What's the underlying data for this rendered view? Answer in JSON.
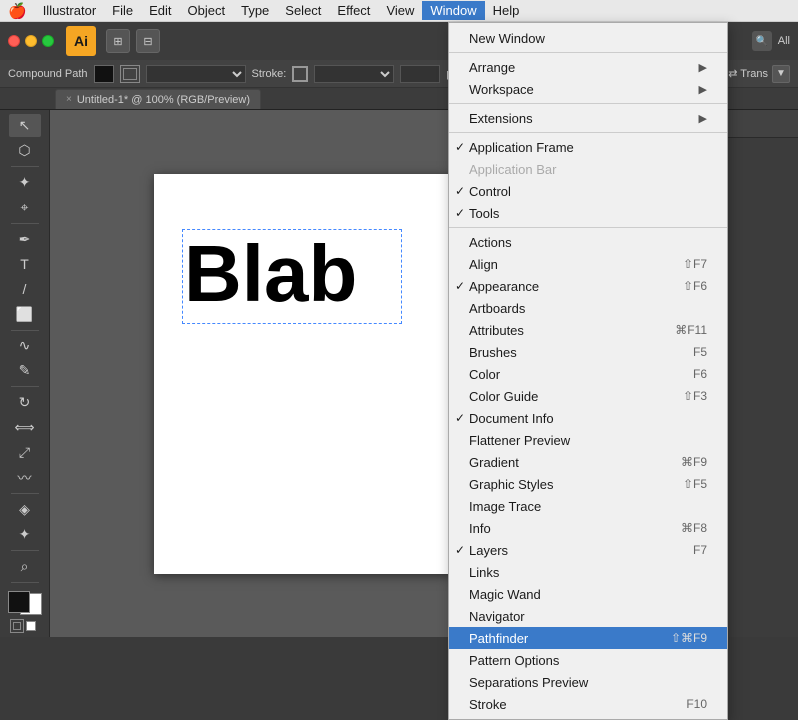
{
  "menubar": {
    "apple": "🍎",
    "items": [
      {
        "label": "Illustrator",
        "active": false
      },
      {
        "label": "File",
        "active": false
      },
      {
        "label": "Edit",
        "active": false
      },
      {
        "label": "Object",
        "active": false
      },
      {
        "label": "Type",
        "active": false
      },
      {
        "label": "Select",
        "active": false
      },
      {
        "label": "Effect",
        "active": false
      },
      {
        "label": "View",
        "active": false
      },
      {
        "label": "Window",
        "active": true
      },
      {
        "label": "Help",
        "active": false
      }
    ]
  },
  "titlebar": {
    "ai_logo": "Ai",
    "icons": [
      "⬜",
      "⬛"
    ]
  },
  "optionsbar": {
    "path_label": "Compound Path",
    "stroke_label": "Stroke:",
    "fill_value": "",
    "stroke_value": ""
  },
  "tab": {
    "close": "×",
    "title": "Untitled-1* @ 100% (RGB/Preview)"
  },
  "canvas": {
    "text": "Blab"
  },
  "window_menu": {
    "items": [
      {
        "label": "New Window",
        "shortcut": "",
        "check": false,
        "disabled": false,
        "submenu": false,
        "separator_after": true
      },
      {
        "label": "Arrange",
        "shortcut": "",
        "check": false,
        "disabled": false,
        "submenu": true,
        "separator_after": false
      },
      {
        "label": "Workspace",
        "shortcut": "",
        "check": false,
        "disabled": false,
        "submenu": true,
        "separator_after": true
      },
      {
        "label": "Extensions",
        "shortcut": "",
        "check": false,
        "disabled": false,
        "submenu": true,
        "separator_after": true
      },
      {
        "label": "Application Frame",
        "shortcut": "",
        "check": true,
        "disabled": false,
        "submenu": false,
        "separator_after": false
      },
      {
        "label": "Application Bar",
        "shortcut": "",
        "check": false,
        "disabled": true,
        "submenu": false,
        "separator_after": false
      },
      {
        "label": "Control",
        "shortcut": "",
        "check": true,
        "disabled": false,
        "submenu": false,
        "separator_after": false
      },
      {
        "label": "Tools",
        "shortcut": "",
        "check": true,
        "disabled": false,
        "submenu": false,
        "separator_after": true
      },
      {
        "label": "Actions",
        "shortcut": "",
        "check": false,
        "disabled": false,
        "submenu": false,
        "separator_after": false
      },
      {
        "label": "Align",
        "shortcut": "⇧F7",
        "check": false,
        "disabled": false,
        "submenu": false,
        "separator_after": false
      },
      {
        "label": "Appearance",
        "shortcut": "⇧F6",
        "check": true,
        "disabled": false,
        "submenu": false,
        "separator_after": false
      },
      {
        "label": "Artboards",
        "shortcut": "",
        "check": false,
        "disabled": false,
        "submenu": false,
        "separator_after": false
      },
      {
        "label": "Attributes",
        "shortcut": "⌘F11",
        "check": false,
        "disabled": false,
        "submenu": false,
        "separator_after": false
      },
      {
        "label": "Brushes",
        "shortcut": "F5",
        "check": false,
        "disabled": false,
        "submenu": false,
        "separator_after": false
      },
      {
        "label": "Color",
        "shortcut": "F6",
        "check": false,
        "disabled": false,
        "submenu": false,
        "separator_after": false
      },
      {
        "label": "Color Guide",
        "shortcut": "⇧F3",
        "check": false,
        "disabled": false,
        "submenu": false,
        "separator_after": false
      },
      {
        "label": "Document Info",
        "shortcut": "",
        "check": true,
        "disabled": false,
        "submenu": false,
        "separator_after": false
      },
      {
        "label": "Flattener Preview",
        "shortcut": "",
        "check": false,
        "disabled": false,
        "submenu": false,
        "separator_after": false
      },
      {
        "label": "Gradient",
        "shortcut": "⌘F9",
        "check": false,
        "disabled": false,
        "submenu": false,
        "separator_after": false
      },
      {
        "label": "Graphic Styles",
        "shortcut": "⇧F5",
        "check": false,
        "disabled": false,
        "submenu": false,
        "separator_after": false
      },
      {
        "label": "Image Trace",
        "shortcut": "",
        "check": false,
        "disabled": false,
        "submenu": false,
        "separator_after": false
      },
      {
        "label": "Info",
        "shortcut": "⌘F8",
        "check": false,
        "disabled": false,
        "submenu": false,
        "separator_after": false
      },
      {
        "label": "Layers",
        "shortcut": "F7",
        "check": true,
        "disabled": false,
        "submenu": false,
        "separator_after": false
      },
      {
        "label": "Links",
        "shortcut": "",
        "check": false,
        "disabled": false,
        "submenu": false,
        "separator_after": false
      },
      {
        "label": "Magic Wand",
        "shortcut": "",
        "check": false,
        "disabled": false,
        "submenu": false,
        "separator_after": false
      },
      {
        "label": "Navigator",
        "shortcut": "",
        "check": false,
        "disabled": false,
        "submenu": false,
        "separator_after": false
      },
      {
        "label": "Pathfinder",
        "shortcut": "⇧⌘F9",
        "check": false,
        "disabled": false,
        "submenu": false,
        "separator_after": false,
        "highlighted": true
      },
      {
        "label": "Pattern Options",
        "shortcut": "",
        "check": false,
        "disabled": false,
        "submenu": false,
        "separator_after": false
      },
      {
        "label": "Separations Preview",
        "shortcut": "",
        "check": false,
        "disabled": false,
        "submenu": false,
        "separator_after": false
      },
      {
        "label": "Stroke",
        "shortcut": "F10",
        "check": false,
        "disabled": false,
        "submenu": false,
        "separator_after": false
      }
    ]
  },
  "tools": [
    {
      "name": "selection-tool",
      "icon": "↖"
    },
    {
      "name": "direct-selection-tool",
      "icon": "⬡"
    },
    {
      "name": "magic-wand-tool",
      "icon": "✦"
    },
    {
      "name": "lasso-tool",
      "icon": "⌖"
    },
    {
      "name": "pen-tool",
      "icon": "✒"
    },
    {
      "name": "text-tool",
      "icon": "T"
    },
    {
      "name": "line-tool",
      "icon": "/"
    },
    {
      "name": "rectangle-tool",
      "icon": "⬜"
    },
    {
      "name": "paintbrush-tool",
      "icon": "𝄘"
    },
    {
      "name": "pencil-tool",
      "icon": "✎"
    },
    {
      "name": "rotate-tool",
      "icon": "↻"
    },
    {
      "name": "mirror-tool",
      "icon": "⟺"
    },
    {
      "name": "scale-tool",
      "icon": "⤢"
    },
    {
      "name": "warp-tool",
      "icon": "〰"
    },
    {
      "name": "blend-tool",
      "icon": "◈"
    },
    {
      "name": "gradient-tool",
      "icon": "◻"
    },
    {
      "name": "eyedropper-tool",
      "icon": "✦"
    },
    {
      "name": "zoom-tool",
      "icon": "⌕"
    }
  ]
}
